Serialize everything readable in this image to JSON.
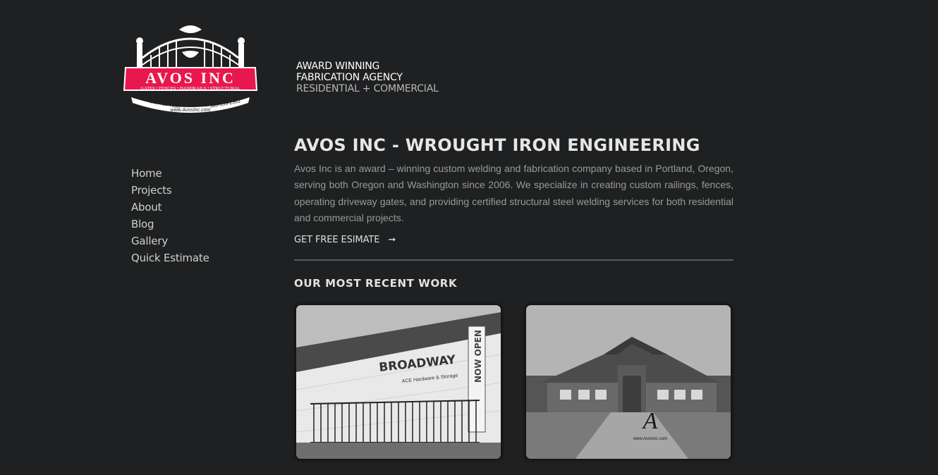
{
  "brand": {
    "logo_name": "AVOS INC",
    "logo_banner": "GATES • FENCES • HANDRAILS • STRUCTURAL",
    "phone_left": "503-719-7030",
    "phone_right": "360-359-2363",
    "url": "www.AvosInc.com",
    "accent_color": "#e8174e"
  },
  "tagline": {
    "line1": "AWARD WINNING",
    "line2": "FABRICATION AGENCY",
    "line3": "RESIDENTIAL + COMMERCIAL"
  },
  "nav": {
    "items": [
      {
        "label": "Home"
      },
      {
        "label": "Projects"
      },
      {
        "label": "About"
      },
      {
        "label": "Blog"
      },
      {
        "label": "Gallery"
      },
      {
        "label": "Quick Estimate"
      }
    ]
  },
  "main": {
    "title": "AVOS INC - WROUGHT IRON ENGINEERING",
    "intro": "Avos Inc is an award – winning custom welding and fabrication company based in Portland, Oregon, serving both Oregon and Washington since 2006. We specialize in creating custom rail­ings, fences, operating driveway gates, and providing certified structural steel welding services for both residential and commercial projects.",
    "cta_label": "GET FREE ESIMATE",
    "cta_icon": "arrow-right-icon",
    "recent_title": "OUR MOST RECENT WORK"
  },
  "work": {
    "card1": {
      "sign": "BROADWAY",
      "sub": "ACE Hardware & Storage",
      "flag": "NOW OPEN"
    },
    "card2": {
      "watermark": "www.AvosInc.com"
    }
  }
}
